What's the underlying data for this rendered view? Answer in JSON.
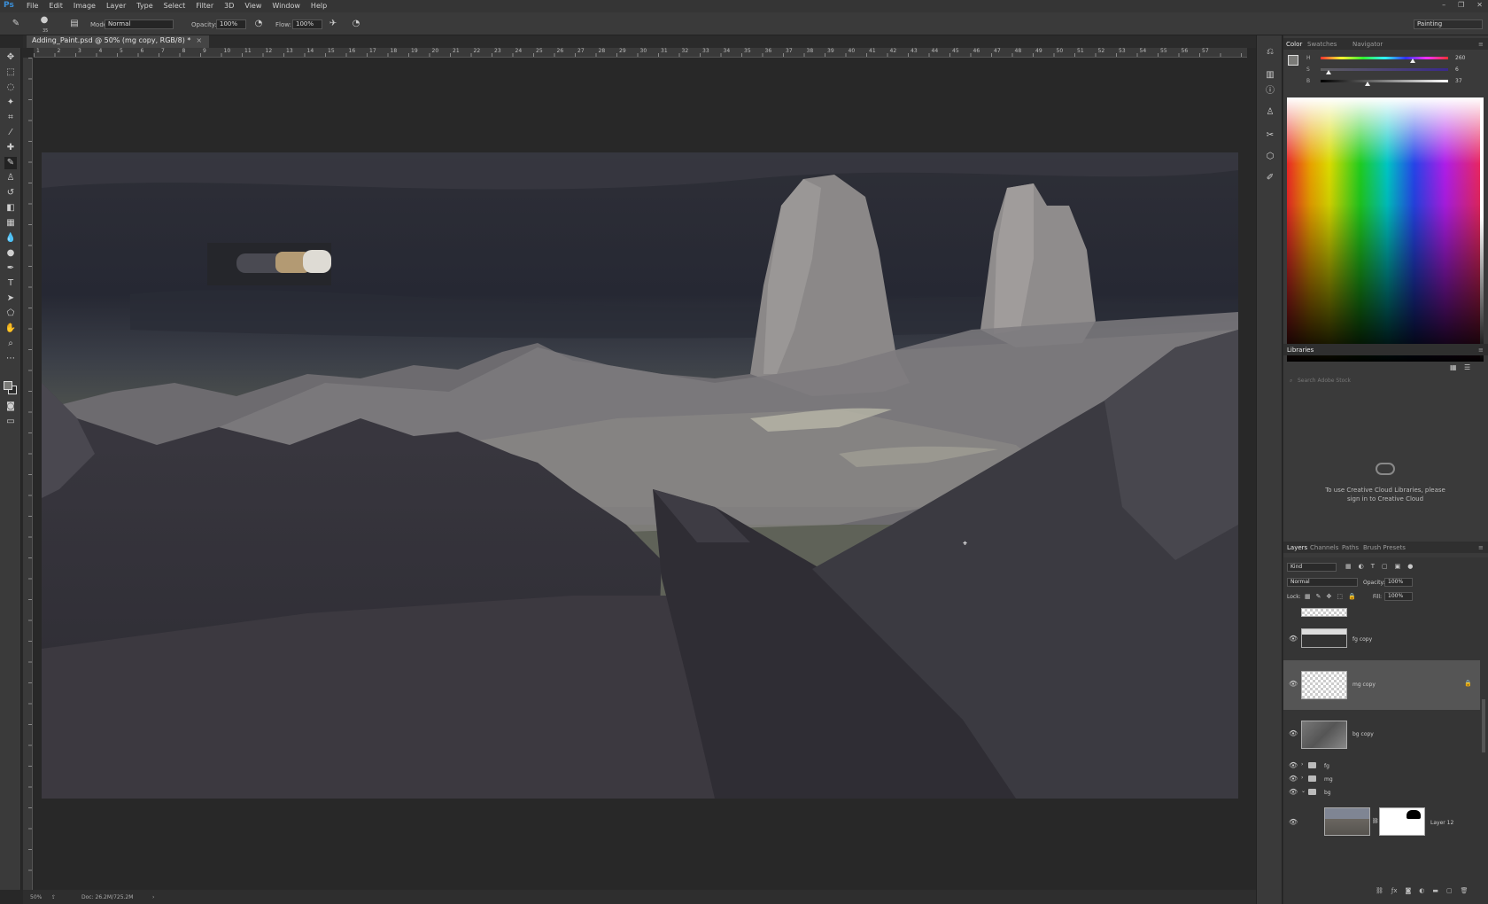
{
  "app": {
    "logo": "Ps",
    "menu": [
      "File",
      "Edit",
      "Image",
      "Layer",
      "Type",
      "Select",
      "Filter",
      "3D",
      "View",
      "Window",
      "Help"
    ],
    "window_controls": [
      "–",
      "❐",
      "✕"
    ]
  },
  "options": {
    "mode_label": "Mode:",
    "mode_value": "Normal",
    "opacity_label": "Opacity:",
    "opacity_value": "100%",
    "flow_label": "Flow:",
    "flow_value": "100%",
    "brush_size": "35",
    "workspace": "Painting"
  },
  "document": {
    "tab_title": "Adding_Paint.psd @ 50% (mg copy, RGB/8) *",
    "tab_close": "×"
  },
  "ruler": {
    "numbers": [
      "1",
      "2",
      "3",
      "4",
      "5",
      "6",
      "7",
      "8",
      "9",
      "10",
      "11",
      "12",
      "13",
      "14",
      "15",
      "16",
      "17",
      "18",
      "19",
      "20",
      "21",
      "22",
      "23",
      "24",
      "25",
      "26",
      "27",
      "28",
      "29",
      "30",
      "31",
      "32",
      "33",
      "34",
      "35",
      "36",
      "37",
      "38",
      "39",
      "40",
      "41",
      "42",
      "43",
      "44",
      "45",
      "46",
      "47",
      "48",
      "49",
      "50",
      "51",
      "52",
      "53",
      "54",
      "55",
      "56",
      "57"
    ]
  },
  "status": {
    "zoom": "50%",
    "doc": "Doc: 26.2M/725.2M"
  },
  "color_panel": {
    "tabs": [
      "Color",
      "Swatches",
      "Navigator"
    ],
    "h_label": "H",
    "s_label": "S",
    "b_label": "B",
    "h_value": "260",
    "s_value": "6",
    "b_value": "37",
    "h_pct": "°",
    "s_pct": "%",
    "b_pct": "%",
    "h_fraction": 0.72,
    "s_fraction": 0.06,
    "b_fraction": 0.37
  },
  "libraries": {
    "title": "Libraries",
    "search_placeholder": "Search Adobe Stock",
    "message": "To use Creative Cloud Libraries, please sign in to Creative Cloud"
  },
  "layers_panel": {
    "tabs": [
      "Layers",
      "Channels",
      "Paths",
      "Brush Presets"
    ],
    "kind": "Kind",
    "blend_mode": "Normal",
    "opacity_label": "Opacity:",
    "opacity_value": "100%",
    "lock_label": "Lock:",
    "fill_label": "Fill:",
    "fill_value": "100%",
    "layers": [
      {
        "name": "fg copy"
      },
      {
        "name": "mg copy"
      },
      {
        "name": "bg copy"
      }
    ],
    "groups": [
      {
        "name": "fg"
      },
      {
        "name": "mg"
      },
      {
        "name": "bg"
      }
    ],
    "bottom_layer": "Layer 12",
    "footer_icons": [
      "link",
      "fx",
      "mask",
      "adjustment",
      "folder",
      "new",
      "trash"
    ]
  },
  "colors": {
    "selected_foreground": "#7b7b78",
    "menubar": "#353535",
    "panel": "#3a3a3a"
  }
}
